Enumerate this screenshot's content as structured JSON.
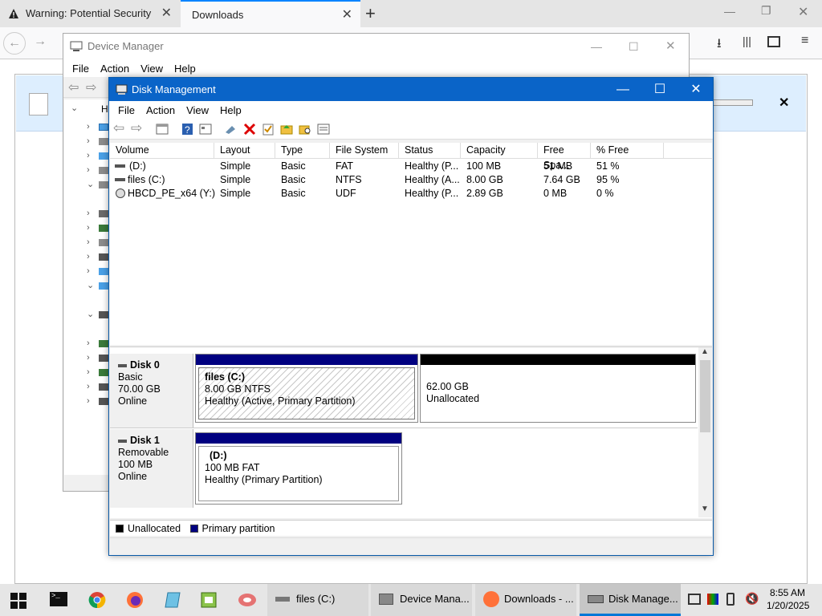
{
  "firefox": {
    "tab1_title": "Warning: Potential Security Risk",
    "tab2_title": "Downloads"
  },
  "devmgr": {
    "title": "Device Manager",
    "menu": [
      "File",
      "Action",
      "View",
      "Help"
    ],
    "root_label": "HI"
  },
  "diskmgmt": {
    "title": "Disk Management",
    "menu": [
      "File",
      "Action",
      "View",
      "Help"
    ],
    "columns": [
      "Volume",
      "Layout",
      "Type",
      "File System",
      "Status",
      "Capacity",
      "Free Spa...",
      "% Free"
    ],
    "volumes": [
      [
        "(D:)",
        "Simple",
        "Basic",
        "FAT",
        "Healthy (P...",
        "100 MB",
        "51 MB",
        "51 %"
      ],
      [
        "files (C:)",
        "Simple",
        "Basic",
        "NTFS",
        "Healthy (A...",
        "8.00 GB",
        "7.64 GB",
        "95 %"
      ],
      [
        "HBCD_PE_x64 (Y:)",
        "Simple",
        "Basic",
        "UDF",
        "Healthy (P...",
        "2.89 GB",
        "0 MB",
        "0 %"
      ]
    ],
    "disk0": {
      "name": "Disk 0",
      "type": "Basic",
      "size": "70.00 GB",
      "status": "Online",
      "p1_name": "files  (C:)",
      "p1_size": "8.00 GB NTFS",
      "p1_status": "Healthy (Active, Primary Partition)",
      "p2_size": "62.00 GB",
      "p2_status": "Unallocated"
    },
    "disk1": {
      "name": "Disk 1",
      "type": "Removable",
      "size": "100 MB",
      "status": "Online",
      "p1_name": "(D:)",
      "p1_size": "100 MB FAT",
      "p1_status": "Healthy (Primary Partition)"
    },
    "legend": [
      "Unallocated",
      "Primary partition"
    ]
  },
  "taskbar": {
    "buttons": [
      "files (C:)",
      "Device Mana...",
      "Downloads - ...",
      "Disk Manage..."
    ],
    "time": "8:55 AM",
    "date": "1/20/2025"
  },
  "colors": {
    "primary_partition": "#000080",
    "unallocated": "#000000",
    "title_active": "#0a64c8"
  }
}
